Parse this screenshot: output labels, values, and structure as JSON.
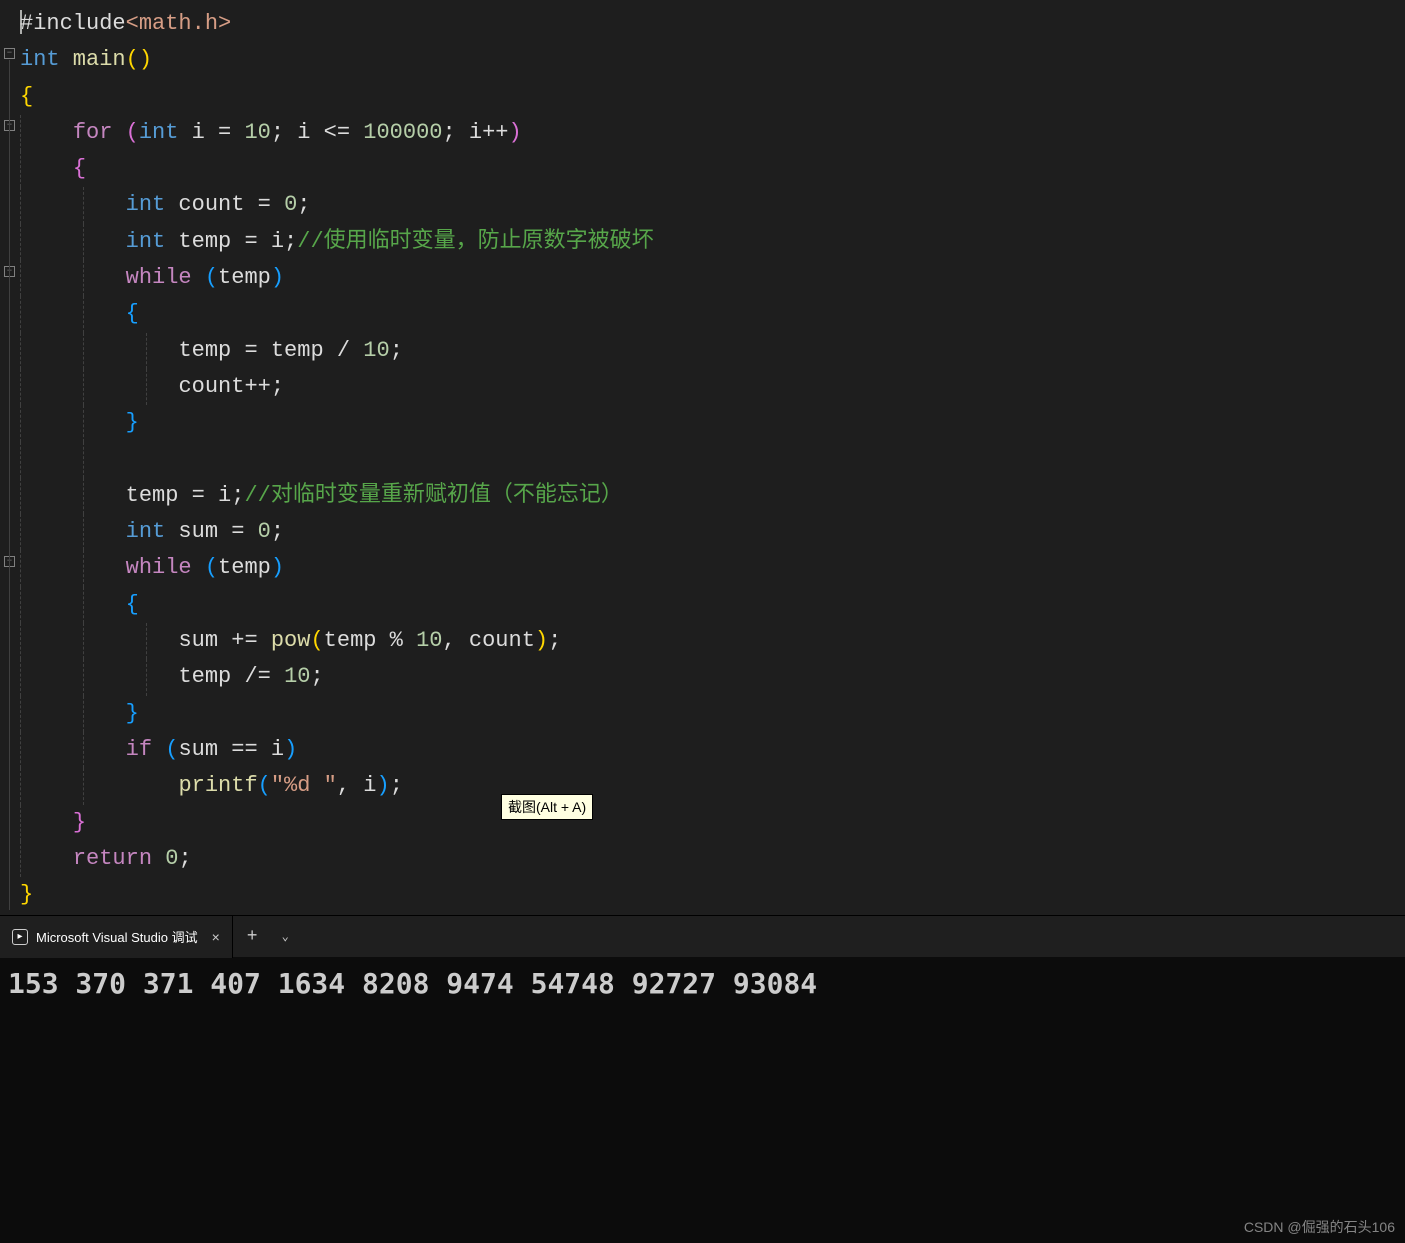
{
  "code": {
    "line1": {
      "include": "#include",
      "header": "<math.h>"
    },
    "line2": {
      "int": "int",
      "main": " main",
      "paren": "()"
    },
    "line3": {
      "brace": "{"
    },
    "line4": {
      "indent": "    ",
      "for": "for",
      "sp": " ",
      "po": "(",
      "int": "int",
      "var": " i ",
      "eq": "= ",
      "n1": "10",
      "sc1": "; ",
      "v2": "i ",
      "le": "<= ",
      "n2": "100000",
      "sc2": "; ",
      "v3": "i",
      "inc": "++",
      "pc": ")"
    },
    "line5": {
      "indent": "    ",
      "brace": "{"
    },
    "line6": {
      "indent": "        ",
      "int": "int",
      "txt": " count = ",
      "n": "0",
      "sc": ";"
    },
    "line7": {
      "indent": "        ",
      "int": "int",
      "txt": " temp = i;",
      "comment": "//使用临时变量，防止原数字被破坏"
    },
    "line8": {
      "indent": "        ",
      "while": "while",
      "sp": " ",
      "po": "(",
      "var": "temp",
      "pc": ")"
    },
    "line9": {
      "indent": "        ",
      "brace": "{"
    },
    "line10": {
      "indent": "            ",
      "txt": "temp = temp / ",
      "n": "10",
      "sc": ";"
    },
    "line11": {
      "indent": "            ",
      "txt": "count++;"
    },
    "line12": {
      "indent": "        ",
      "brace": "}"
    },
    "line13": {
      "indent": ""
    },
    "line14": {
      "indent": "        ",
      "txt": "temp = i;",
      "comment": "//对临时变量重新赋初值（不能忘记）"
    },
    "line15": {
      "indent": "        ",
      "int": "int",
      "txt": " sum = ",
      "n": "0",
      "sc": ";"
    },
    "line16": {
      "indent": "        ",
      "while": "while",
      "sp": " ",
      "po": "(",
      "var": "temp",
      "pc": ")"
    },
    "line17": {
      "indent": "        ",
      "brace": "{"
    },
    "line18": {
      "indent": "            ",
      "txt1": "sum += ",
      "fn": "pow",
      "po": "(",
      "txt2": "temp % ",
      "n1": "10",
      "c": ", ",
      "txt3": "count",
      "pc": ")",
      "sc": ";"
    },
    "line19": {
      "indent": "            ",
      "txt": "temp /= ",
      "n": "10",
      "sc": ";"
    },
    "line20": {
      "indent": "        ",
      "brace": "}"
    },
    "line21": {
      "indent": "        ",
      "if": "if",
      "sp": " ",
      "po": "(",
      "txt": "sum == i",
      "pc": ")"
    },
    "line22": {
      "indent": "            ",
      "fn": "printf",
      "po": "(",
      "str": "\"%d \"",
      "c": ", i",
      "pc": ")",
      "sc": ";"
    },
    "line23": {
      "indent": "    ",
      "brace": "}"
    },
    "line24": {
      "indent": "    ",
      "return": "return",
      "sp": " ",
      "n": "0",
      "sc": ";"
    },
    "line25": {
      "brace": "}"
    }
  },
  "tooltip": "截图(Alt + A)",
  "tab": {
    "title": "Microsoft Visual Studio 调试",
    "add": "+",
    "close": "×",
    "dropdown": "⌄"
  },
  "console": {
    "output": "153  370  371  407  1634  8208  9474  54748  92727  93084"
  },
  "watermark": "CSDN @倔强的石头106"
}
